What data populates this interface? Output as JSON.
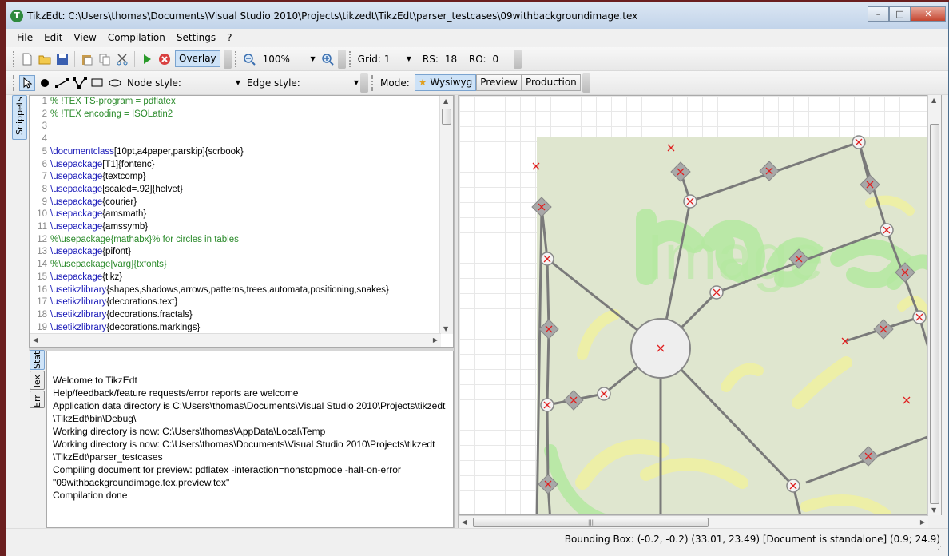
{
  "window": {
    "title": "TikzEdt: C:\\Users\\thomas\\Documents\\Visual Studio 2010\\Projects\\tikzedt\\TikzEdt\\parser_testcases\\09withbackgroundimage.tex",
    "icon_letter": "T",
    "minimize": "–",
    "maximize": "□",
    "close": "✕"
  },
  "menu": [
    "File",
    "Edit",
    "View",
    "Compilation",
    "Settings",
    "?"
  ],
  "toolbar1": {
    "overlay_label": "Overlay",
    "zoom_value": "100%",
    "grid_label": "Grid:",
    "grid_value": "1",
    "rs_label": "RS:",
    "rs_value": "18",
    "ro_label": "RO:",
    "ro_value": "0"
  },
  "toolbar2": {
    "node_style_label": "Node style:",
    "edge_style_label": "Edge style:",
    "mode_label": "Mode:",
    "modes": [
      "Wysiwyg",
      "Preview",
      "Production"
    ],
    "active_mode": "Wysiwyg"
  },
  "side_tabs": {
    "snippets": "Snippets",
    "stat": "Stat",
    "tex": "Tex",
    "err": "Err"
  },
  "editor_lines": [
    {
      "n": "1",
      "parts": [
        {
          "t": "% !TEX TS-program = pdflatex",
          "c": "cm"
        }
      ]
    },
    {
      "n": "2",
      "parts": [
        {
          "t": "% !TEX encoding = ISOLatin2",
          "c": "cm"
        }
      ]
    },
    {
      "n": "3",
      "parts": []
    },
    {
      "n": "4",
      "parts": []
    },
    {
      "n": "5",
      "parts": [
        {
          "t": "\\documentclass",
          "c": "kw"
        },
        {
          "t": "[10pt,a4paper,parskip]{scrbook}",
          "c": ""
        }
      ]
    },
    {
      "n": "6",
      "parts": [
        {
          "t": "\\usepackage",
          "c": "kw"
        },
        {
          "t": "[T1]{fontenc}",
          "c": ""
        }
      ]
    },
    {
      "n": "7",
      "parts": [
        {
          "t": "\\usepackage",
          "c": "kw"
        },
        {
          "t": "{textcomp}",
          "c": ""
        }
      ]
    },
    {
      "n": "8",
      "parts": [
        {
          "t": "\\usepackage",
          "c": "kw"
        },
        {
          "t": "[scaled=.92]{helvet}",
          "c": ""
        }
      ]
    },
    {
      "n": "9",
      "parts": [
        {
          "t": "\\usepackage",
          "c": "kw"
        },
        {
          "t": "{courier}",
          "c": ""
        }
      ]
    },
    {
      "n": "10",
      "parts": [
        {
          "t": "\\usepackage",
          "c": "kw"
        },
        {
          "t": "{amsmath}",
          "c": ""
        }
      ]
    },
    {
      "n": "11",
      "parts": [
        {
          "t": "\\usepackage",
          "c": "kw"
        },
        {
          "t": "{amssymb}",
          "c": ""
        }
      ]
    },
    {
      "n": "12",
      "parts": [
        {
          "t": "%\\usepackage{mathabx}% for circles in tables",
          "c": "cm"
        }
      ]
    },
    {
      "n": "13",
      "parts": [
        {
          "t": "\\usepackage",
          "c": "kw"
        },
        {
          "t": "{pifont}",
          "c": ""
        }
      ]
    },
    {
      "n": "14",
      "parts": [
        {
          "t": "%\\usepackage[varg]{txfonts}",
          "c": "cm"
        }
      ]
    },
    {
      "n": "15",
      "parts": [
        {
          "t": "\\usepackage",
          "c": "kw"
        },
        {
          "t": "{tikz}",
          "c": ""
        }
      ]
    },
    {
      "n": "16",
      "parts": [
        {
          "t": "\\usetikzlibrary",
          "c": "kw"
        },
        {
          "t": "{shapes,shadows,arrows,patterns,trees,automata,positioning,snakes}",
          "c": ""
        }
      ]
    },
    {
      "n": "17",
      "parts": [
        {
          "t": "\\usetikzlibrary",
          "c": "kw"
        },
        {
          "t": "{decorations.text}",
          "c": ""
        }
      ]
    },
    {
      "n": "18",
      "parts": [
        {
          "t": "\\usetikzlibrary",
          "c": "kw"
        },
        {
          "t": "{decorations.fractals}",
          "c": ""
        }
      ]
    },
    {
      "n": "19",
      "parts": [
        {
          "t": "\\usetikzlibrary",
          "c": "kw"
        },
        {
          "t": "{decorations.markings}",
          "c": ""
        }
      ]
    }
  ],
  "output_lines": [
    "Welcome to TikzEdt",
    "Help/feedback/feature requests/error reports are welcome",
    "Application data directory is C:\\Users\\thomas\\Documents\\Visual Studio 2010\\Projects\\tikzedt",
    "\\TikzEdt\\bin\\Debug\\",
    "Working directory is now: C:\\Users\\thomas\\AppData\\Local\\Temp",
    "Working directory is now: C:\\Users\\thomas\\Documents\\Visual Studio 2010\\Projects\\tikzedt",
    "\\TikzEdt\\parser_testcases",
    "Compiling document for preview: pdflatex -interaction=nonstopmode -halt-on-error",
    "\"09withbackgroundimage.tex.preview.tex\"",
    "Compilation done"
  ],
  "status": {
    "text": "Bounding Box: (-0.2, -0.2) (33.01, 23.49)  [Document is standalone]  (0.9; 24.9)"
  },
  "preview": {
    "background_word": "Image",
    "colors": {
      "bg": "#dfe6cf",
      "glow_green": "#b4e8a0",
      "glow_yellow": "#f0f0a0",
      "edge": "#7a7a7a",
      "cross": "#e02020"
    }
  }
}
